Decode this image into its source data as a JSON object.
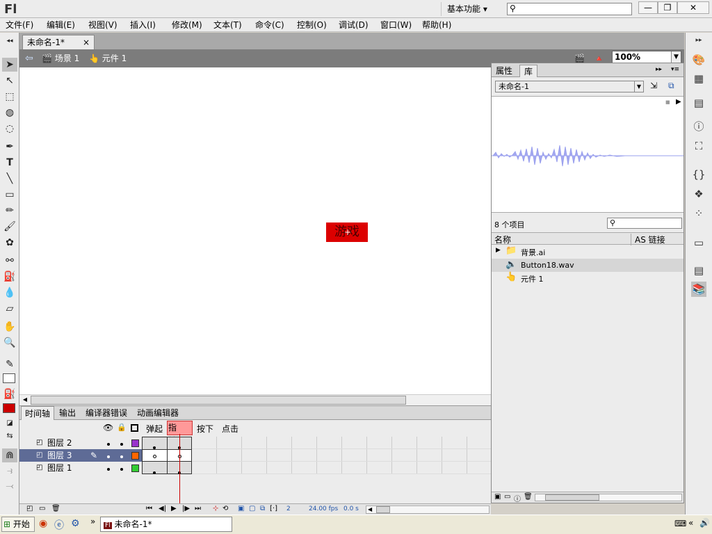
{
  "app": {
    "logo": "Fl",
    "workspace": "基本功能 ▾",
    "search_placeholder": ""
  },
  "window_buttons": {
    "minimize": "—",
    "restore": "❐",
    "close": "✕"
  },
  "menu": [
    "文件(F)",
    "编辑(E)",
    "视图(V)",
    "插入(I)",
    "修改(M)",
    "文本(T)",
    "命令(C)",
    "控制(O)",
    "调试(D)",
    "窗口(W)",
    "帮助(H)"
  ],
  "document_tab": {
    "label": "未命名-1*",
    "close": "×"
  },
  "breadcrumb": {
    "scene": "场景 1",
    "symbol": "元件 1"
  },
  "zoom": "100%",
  "stage": {
    "button_text": "游戏"
  },
  "panel": {
    "tabs": [
      "属性",
      "库"
    ],
    "library_name": "未命名-1",
    "item_count": "8 个项目",
    "columns": {
      "name": "名称",
      "linkage": "AS 链接"
    },
    "items": [
      {
        "name": "背景.ai",
        "icon": "folder-icon"
      },
      {
        "name": "Button18.wav",
        "icon": "sound-icon"
      },
      {
        "name": "元件 1",
        "icon": "button-symbol-icon"
      }
    ]
  },
  "timeline": {
    "tabs": [
      "时间轴",
      "输出",
      "编译器错误",
      "动画编辑器"
    ],
    "frame_labels": [
      "弹起",
      "指针...",
      "按下",
      "点击"
    ],
    "layers": [
      {
        "name": "图层 2",
        "color": "#9933cc"
      },
      {
        "name": "图层 3",
        "color": "#ff6600"
      },
      {
        "name": "图层 1",
        "color": "#33cc33"
      }
    ],
    "status": {
      "frame": "2",
      "fps": "24.00 fps",
      "time": "0.0 s"
    }
  },
  "taskbar": {
    "start": "开始",
    "window": "未命名-1*"
  },
  "colors": {
    "stroke": "#000000",
    "fill": "#cc0000",
    "stage_button": "#dc0000"
  }
}
